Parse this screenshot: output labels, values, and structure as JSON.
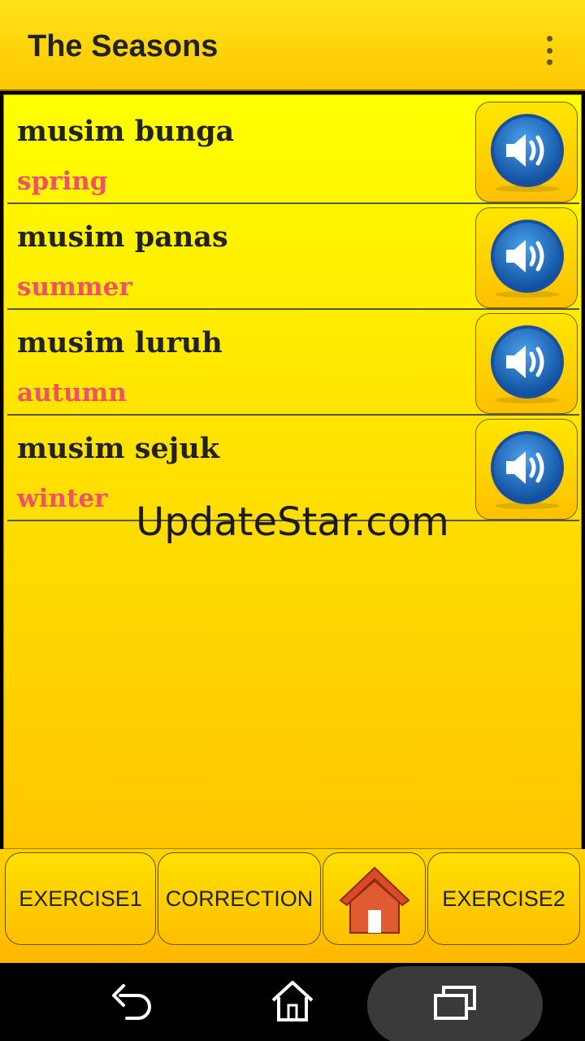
{
  "appbar": {
    "title": "The Seasons",
    "menu_icon": "overflow-menu-icon"
  },
  "items": [
    {
      "word": "musim bunga",
      "translation": "spring",
      "icon": "speaker-icon"
    },
    {
      "word": "musim panas",
      "translation": "summer",
      "icon": "speaker-icon"
    },
    {
      "word": "musim luruh",
      "translation": "autumn",
      "icon": "speaker-icon"
    },
    {
      "word": "musim sejuk",
      "translation": "winter",
      "icon": "speaker-icon"
    }
  ],
  "watermark": "UpdateStar.com",
  "bottom": {
    "exercise1": "EXERCISE1",
    "correction": "CORRECTION",
    "home_icon": "home-icon",
    "exercise2": "EXERCISE2"
  },
  "navbar": {
    "back_icon": "back-icon",
    "home_icon": "home-outline-icon",
    "recents_icon": "recents-icon"
  },
  "colors": {
    "accent": "#ffd400",
    "translation": "#f0506a",
    "speaker": "#1e6fc4"
  }
}
